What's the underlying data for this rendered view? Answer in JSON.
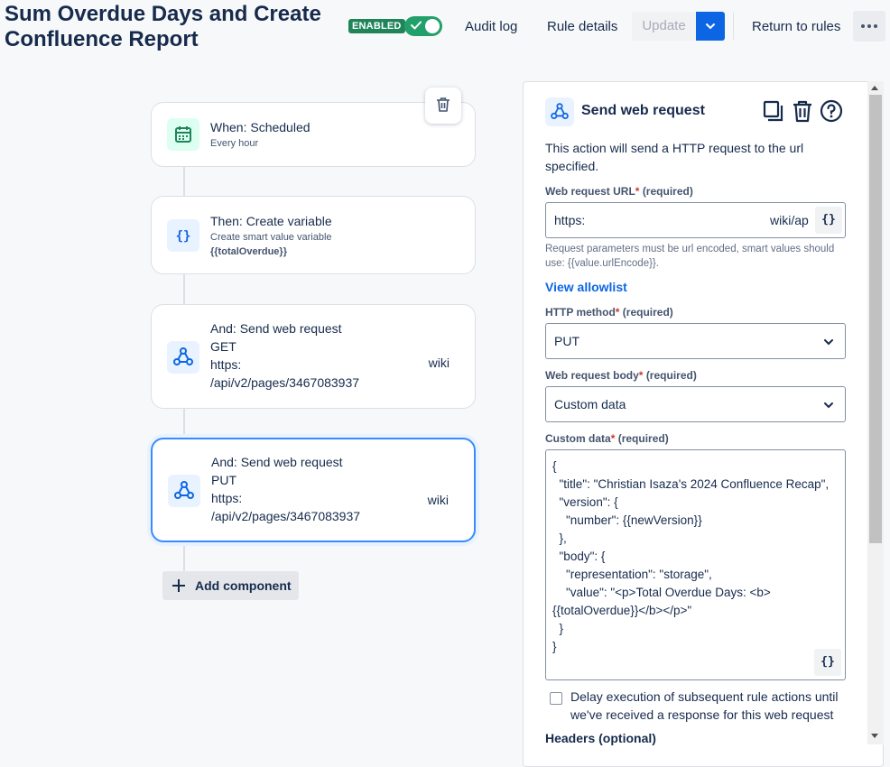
{
  "header": {
    "title": "Sum Overdue Days and Create Confluence Report",
    "status_badge": "ENABLED",
    "audit_log": "Audit log",
    "rule_details": "Rule details",
    "update": "Update",
    "return_to_rules": "Return to rules"
  },
  "flow": {
    "trigger": {
      "title": "When: Scheduled",
      "subtitle": "Every hour"
    },
    "create_variable": {
      "title": "Then: Create variable",
      "subtitle": "Create smart value variable",
      "variable": "{{totalOverdue}}"
    },
    "web_request_get": {
      "title": "And: Send web request",
      "method": "GET",
      "url_start": "https:",
      "url_end": "wiki",
      "path": "/api/v2/pages/3467083937"
    },
    "web_request_put": {
      "title": "And: Send web request",
      "method": "PUT",
      "url_start": "https:",
      "url_end": "wiki",
      "path": "/api/v2/pages/3467083937"
    },
    "add_component": "Add component"
  },
  "panel": {
    "title": "Send web request",
    "description": "This action will send a HTTP request to the url specified.",
    "url_field": {
      "label": "Web request URL",
      "required": "(required)",
      "value_start": "https:",
      "value_end": "wiki/ap"
    },
    "url_help": "Request parameters must be url encoded, smart values should use: {{value.urlEncode}}.",
    "view_allowlist": "View allowlist",
    "method_field": {
      "label": "HTTP method",
      "required": "(required)",
      "value": "PUT"
    },
    "body_field": {
      "label": "Web request body",
      "required": "(required)",
      "value": "Custom data"
    },
    "custom_data": {
      "label": "Custom data",
      "required": "(required)",
      "value": "{\n  \"title\": \"Christian Isaza's 2024 Confluence Recap\",\n  \"version\": {\n    \"number\": {{newVersion}}\n  },\n  \"body\": {\n    \"representation\": \"storage\",\n    \"value\": \"<p>Total Overdue Days: <b>\n{{totalOverdue}}</b></p>\"\n  }\n}"
    },
    "smart_value_button": "{}",
    "delay_checkbox": {
      "label": "Delay execution of subsequent rule actions until we've received a response for this web request",
      "checked": false
    },
    "headers_label": "Headers (optional)"
  },
  "colors": {
    "accent": "#0c66e4",
    "enabled_green": "#1f845a",
    "selected_border": "#388bff",
    "required_star": "#c9372c"
  }
}
